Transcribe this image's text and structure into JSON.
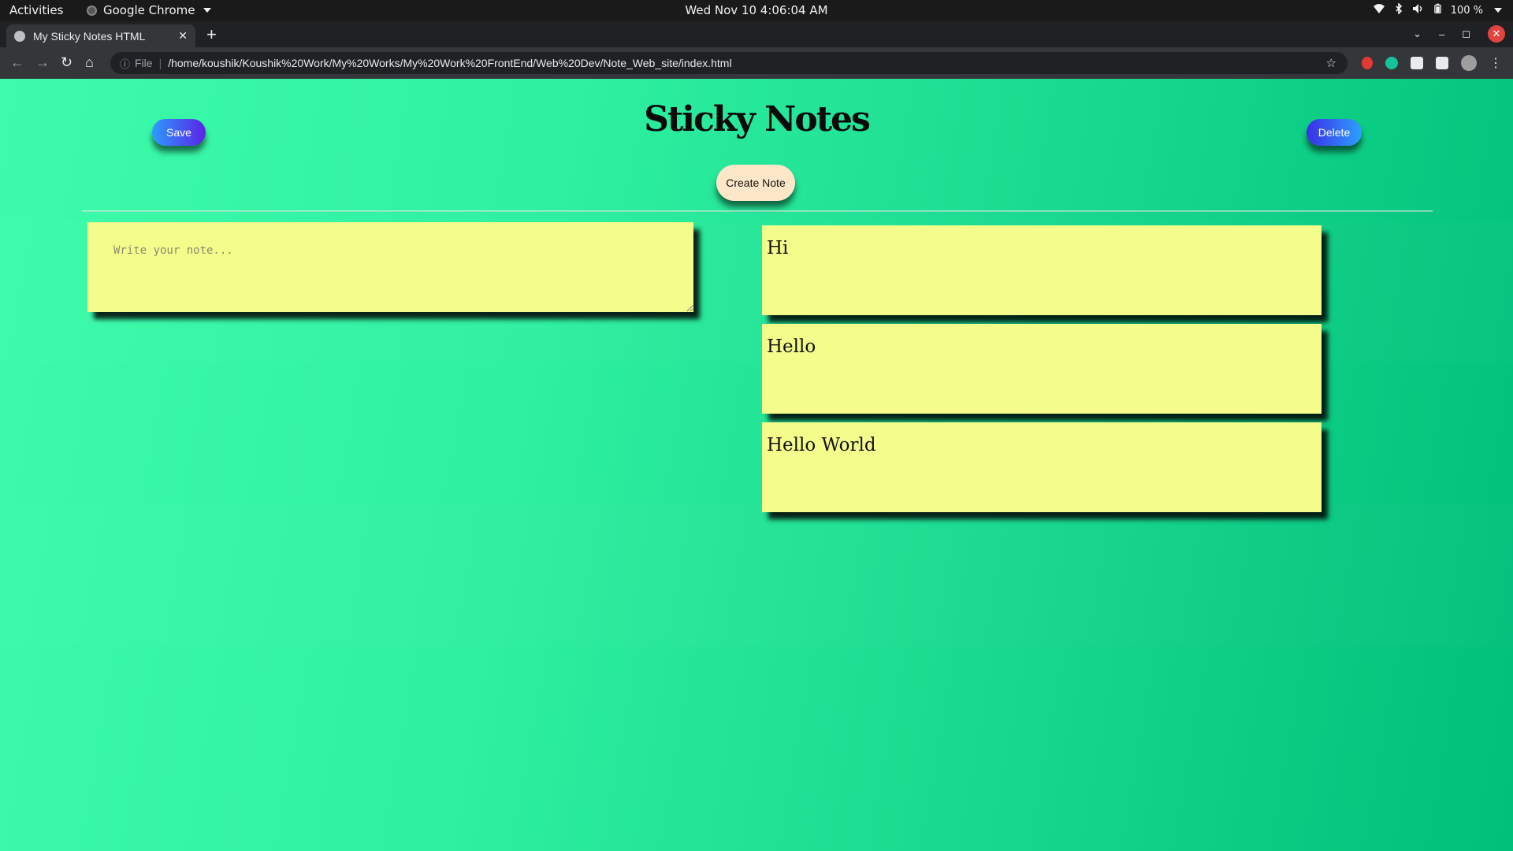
{
  "system_bar": {
    "activities": "Activities",
    "app_name": "Google Chrome",
    "clock": "Wed Nov 10  4:06:04 AM",
    "battery": "100 %"
  },
  "browser": {
    "tab_title": "My Sticky Notes HTML",
    "address_scheme": "File",
    "url": "/home/koushik/Koushik%20Work/My%20Works/My%20Work%20FrontEnd/Web%20Dev/Note_Web_site/index.html"
  },
  "page": {
    "title": "Sticky Notes",
    "save_label": "Save",
    "delete_label": "Delete",
    "create_label": "Create Note",
    "editor_placeholder": "Write your note...",
    "notes": [
      "Hi",
      "Hello",
      "Hello World"
    ]
  },
  "colors": {
    "background_start": "#3dfcac",
    "background_end": "#00c07a",
    "note": "#f4fc8c",
    "create_button": "#fde7c8",
    "button_gradient_a": "#2e9bff",
    "button_gradient_b": "#5a22e6"
  }
}
